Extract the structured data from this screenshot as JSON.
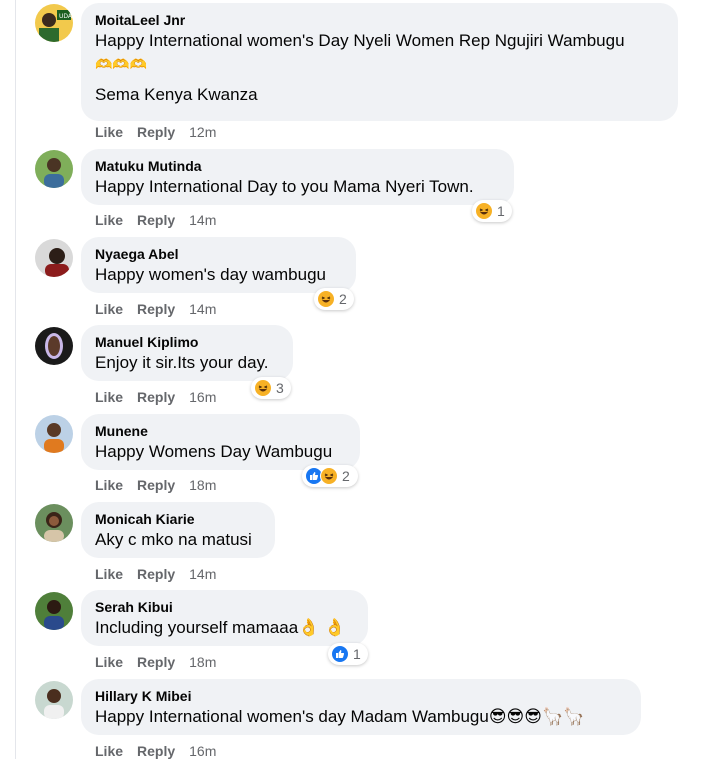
{
  "comments": [
    {
      "author": "MoitaLeel Jnr",
      "text": "Happy International women's Day Nyeli Women Rep Ngujiri Wambugu",
      "emoji_line": "🫶🫶🫶",
      "text2": "Sema Kenya Kwanza",
      "like": "Like",
      "reply": "Reply",
      "time": "12m",
      "reactions": null
    },
    {
      "author": "Matuku Mutinda",
      "text": "Happy International Day to you Mama Nyeri Town.",
      "like": "Like",
      "reply": "Reply",
      "time": "14m",
      "reactions": {
        "types": [
          "haha"
        ],
        "count": "1"
      }
    },
    {
      "author": "Nyaega Abel",
      "text": "Happy women's day wambugu",
      "like": "Like",
      "reply": "Reply",
      "time": "14m",
      "reactions": {
        "types": [
          "haha"
        ],
        "count": "2"
      }
    },
    {
      "author": "Manuel Kiplimo",
      "text": "Enjoy it sir.Its your day.",
      "like": "Like",
      "reply": "Reply",
      "time": "16m",
      "reactions": {
        "types": [
          "haha"
        ],
        "count": "3"
      }
    },
    {
      "author": "Munene",
      "text": "Happy Womens Day Wambugu",
      "like": "Like",
      "reply": "Reply",
      "time": "18m",
      "reactions": {
        "types": [
          "like",
          "haha"
        ],
        "count": "2"
      }
    },
    {
      "author": "Monicah Kiarie",
      "text": "Aky c mko na matusi",
      "like": "Like",
      "reply": "Reply",
      "time": "14m",
      "reactions": null
    },
    {
      "author": "Serah Kibui",
      "text": "Including yourself mamaaa👌 👌",
      "like": "Like",
      "reply": "Reply",
      "time": "18m",
      "reactions": {
        "types": [
          "like"
        ],
        "count": "1"
      }
    },
    {
      "author": "Hillary K Mibei",
      "text": "Happy International women's day Madam Wambugu😎😎😎🦙🦙",
      "like": "Like",
      "reply": "Reply",
      "time": "16m",
      "reactions": null
    }
  ],
  "colors": {
    "bubble_bg": "#f0f2f5",
    "meta_text": "#65676b",
    "like_blue": "#1877f2",
    "haha_yellow": "#f7b125"
  },
  "icons": {
    "haha": "haha-reaction-icon",
    "like": "like-reaction-icon"
  }
}
